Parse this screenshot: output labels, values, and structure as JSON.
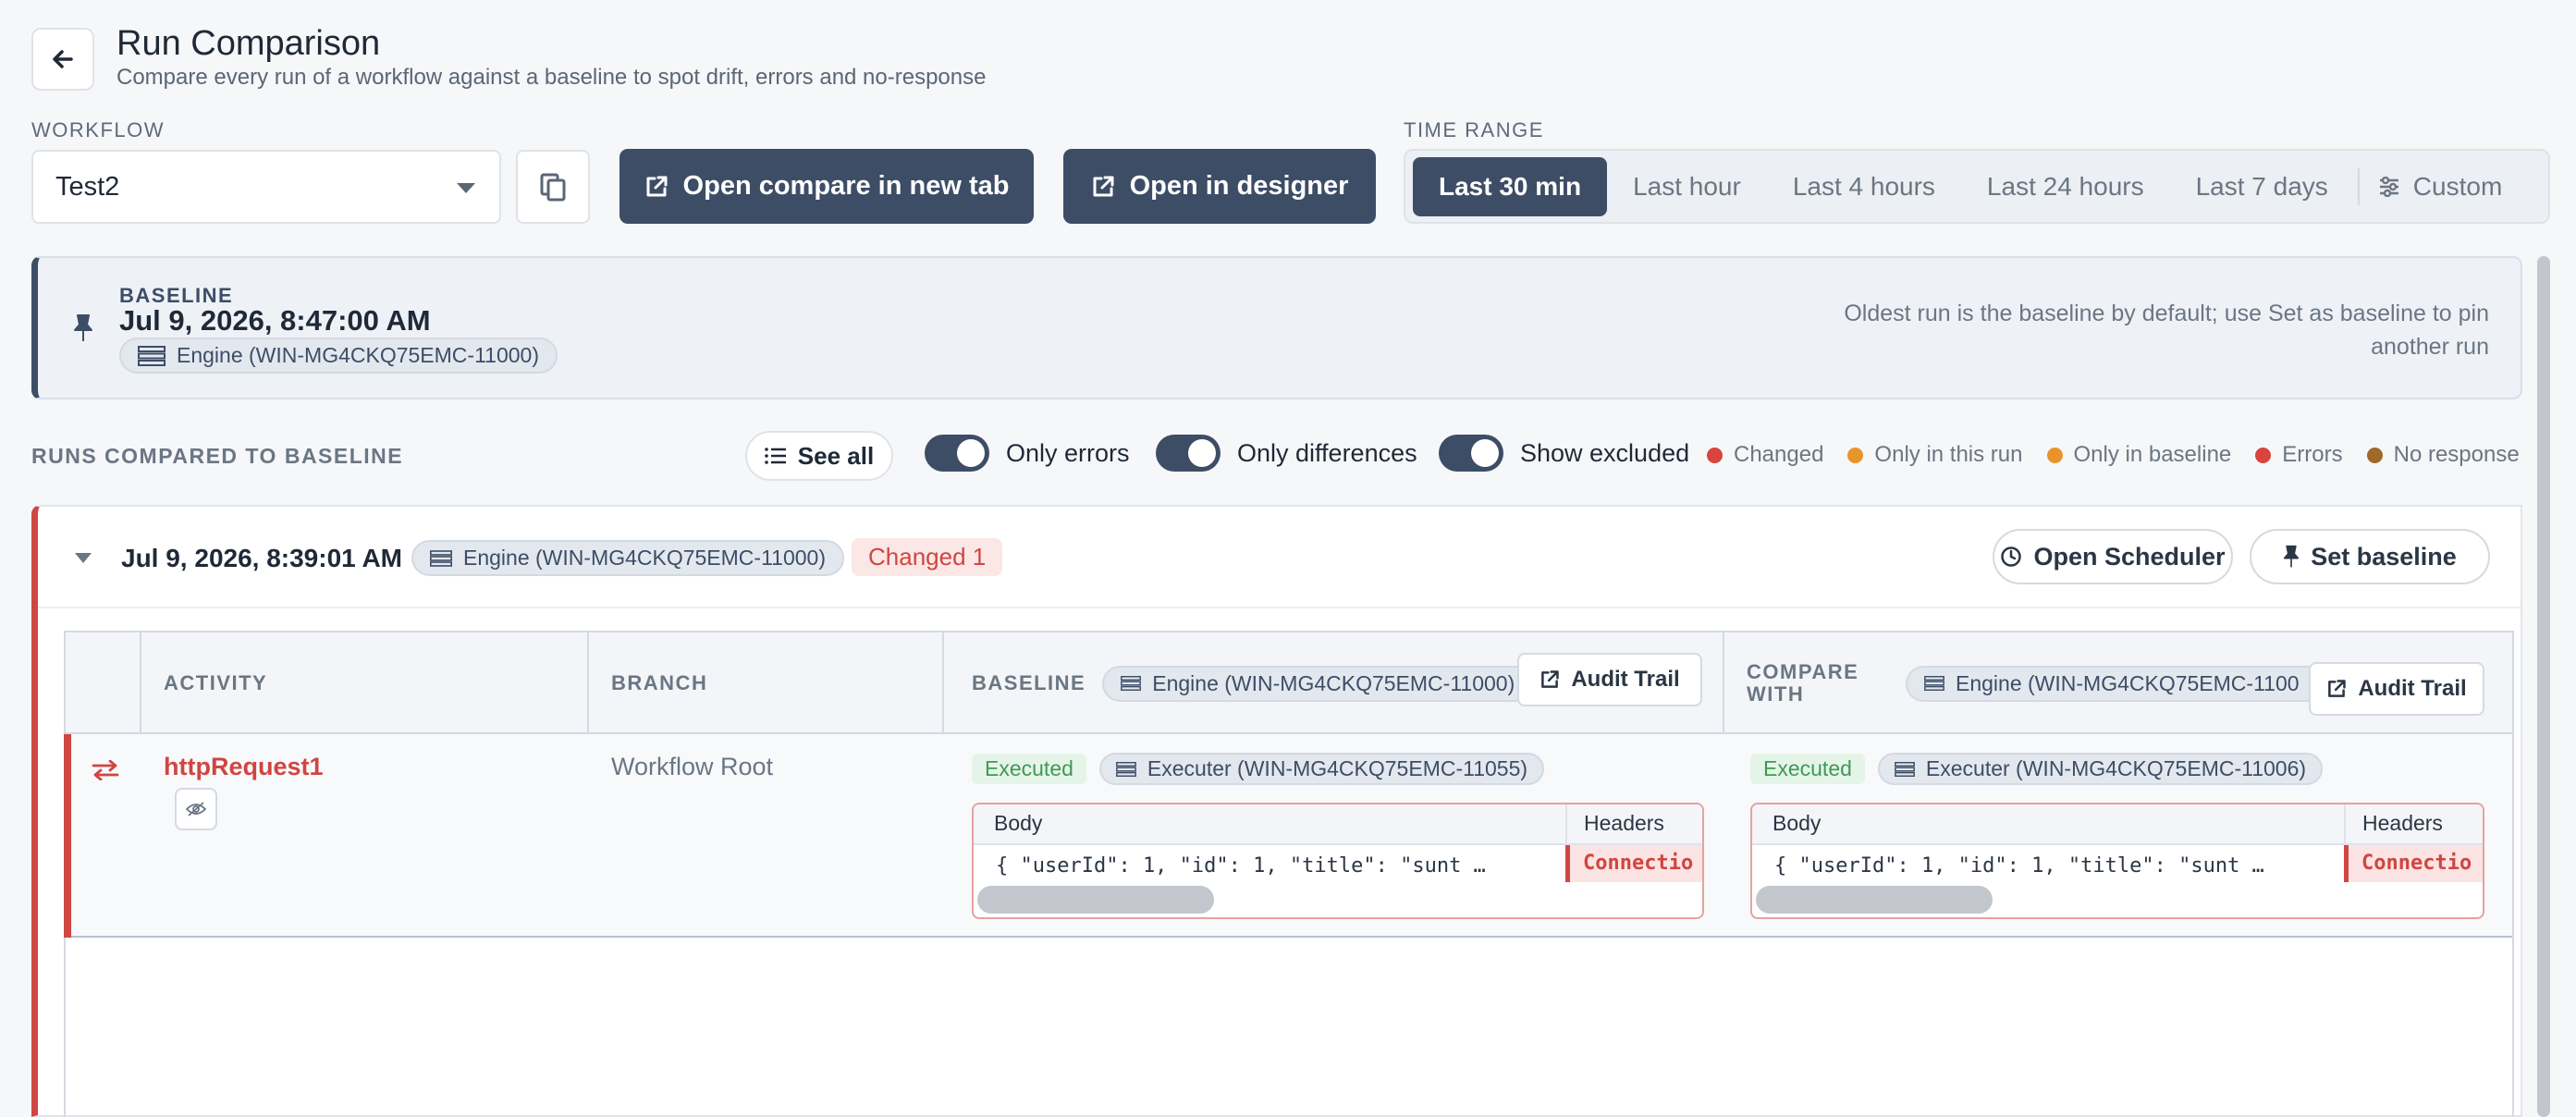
{
  "header": {
    "title": "Run Comparison",
    "subtitle": "Compare every run of a workflow against a baseline to spot drift, errors and no-response",
    "back_icon": "arrow-left-icon"
  },
  "workflow": {
    "label": "WORKFLOW",
    "selected": "Test2"
  },
  "actions": {
    "open_compare": "Open compare in new tab",
    "open_designer": "Open in designer"
  },
  "time_range": {
    "label": "TIME RANGE",
    "options": [
      "Last 30 min",
      "Last hour",
      "Last 4 hours",
      "Last 24 hours",
      "Last 7 days"
    ],
    "active": "Last 30 min",
    "custom": "Custom"
  },
  "baseline": {
    "label": "BASELINE",
    "date": "Jul 9, 2026, 8:47:00 AM",
    "engine": "Engine (WIN-MG4CKQ75EMC-11000)",
    "note": "Oldest run is the baseline by default; use Set as baseline to pin another run"
  },
  "runs": {
    "label": "RUNS COMPARED TO BASELINE",
    "see_all": "See all",
    "toggles": {
      "only_errors": "Only errors",
      "only_differences": "Only differences",
      "show_excluded": "Show excluded"
    },
    "legend": [
      {
        "label": "Changed",
        "color": "#d9443f"
      },
      {
        "label": "Only in this run",
        "color": "#e8942c"
      },
      {
        "label": "Only in baseline",
        "color": "#e8942c"
      },
      {
        "label": "Errors",
        "color": "#d9443f"
      },
      {
        "label": "No response",
        "color": "#a0682a"
      }
    ]
  },
  "run": {
    "date": "Jul 9, 2026, 8:39:01 AM",
    "engine": "Engine (WIN-MG4CKQ75EMC-11000)",
    "changed": "Changed 1",
    "open_scheduler": "Open Scheduler",
    "set_baseline": "Set baseline",
    "table": {
      "col_activity": "ACTIVITY",
      "col_branch": "BRANCH",
      "col_baseline": "BASELINE",
      "baseline_engine": "Engine (WIN-MG4CKQ75EMC-11000)",
      "audit_trail": "Audit Trail",
      "col_compare": "COMPARE WITH",
      "compare_engine": "Engine (WIN-MG4CKQ75EMC-1100",
      "rows": [
        {
          "activity": "httpRequest1",
          "branch": "Workflow Root",
          "baseline_status": "Executed",
          "baseline_executer": "Executer (WIN-MG4CKQ75EMC-11055)",
          "compare_status": "Executed",
          "compare_executer": "Executer (WIN-MG4CKQ75EMC-11006)",
          "body_header": "Body",
          "headers_header": "Headers",
          "baseline_body": "{ \"userId\": 1, \"id\": 1, \"title\": \"sunt …",
          "baseline_headers": "Connectio",
          "compare_body": "{ \"userId\": 1, \"id\": 1, \"title\": \"sunt …",
          "compare_headers": "Connectio"
        }
      ]
    }
  }
}
